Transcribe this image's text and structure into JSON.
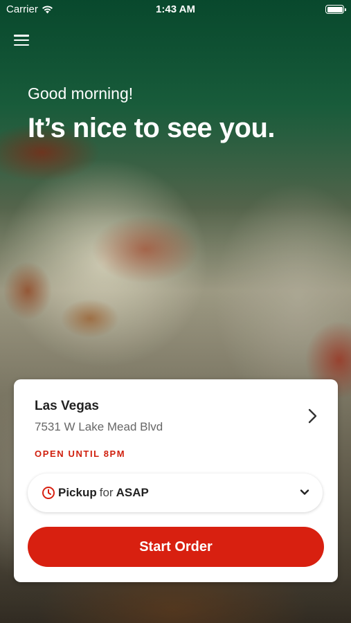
{
  "status_bar": {
    "carrier": "Carrier",
    "time": "1:43 AM"
  },
  "hero": {
    "greeting": "Good morning!",
    "headline": "It’s nice to see you."
  },
  "location_card": {
    "name": "Las Vegas",
    "address": "7531 W Lake Mead Blvd",
    "hours": "OPEN UNTIL 8PM",
    "order_mode": {
      "mode": "Pickup",
      "connector": "for",
      "time": "ASAP"
    },
    "start_label": "Start Order"
  },
  "colors": {
    "accent": "#d82010",
    "hours_text": "#d0200e"
  },
  "icons": [
    "wifi-icon",
    "battery-icon",
    "menu-icon",
    "chevron-right-icon",
    "clock-icon",
    "chevron-down-icon"
  ]
}
